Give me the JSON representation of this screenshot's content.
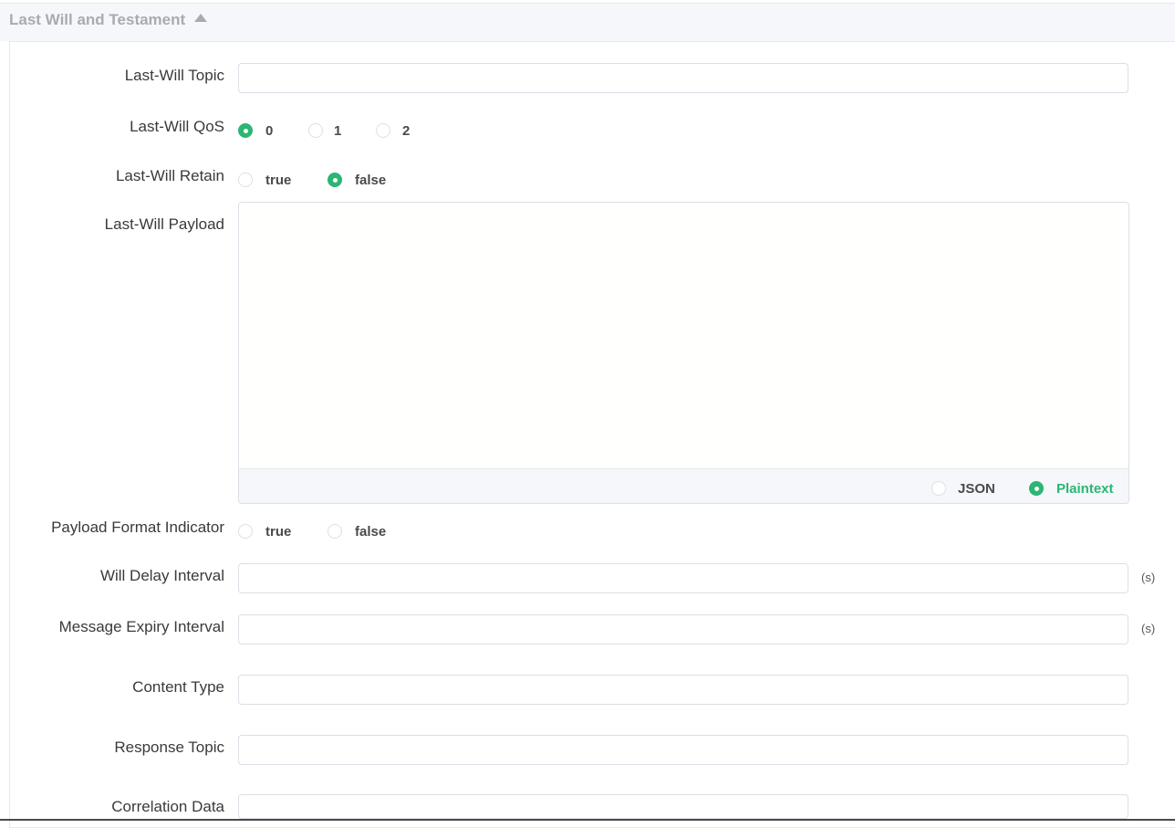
{
  "section": {
    "title": "Last Will and Testament"
  },
  "fields": {
    "topic": {
      "label": "Last-Will Topic",
      "value": ""
    },
    "qos": {
      "label": "Last-Will QoS",
      "options": [
        "0",
        "1",
        "2"
      ],
      "selected": "0"
    },
    "retain": {
      "label": "Last-Will Retain",
      "options": [
        "true",
        "false"
      ],
      "selected": "false"
    },
    "payload": {
      "label": "Last-Will Payload",
      "value": "",
      "formats": [
        "JSON",
        "Plaintext"
      ],
      "selected_format": "Plaintext"
    },
    "payload_format_indicator": {
      "label": "Payload Format Indicator",
      "options": [
        "true",
        "false"
      ],
      "selected": ""
    },
    "will_delay_interval": {
      "label": "Will Delay Interval",
      "value": "",
      "unit": "(s)"
    },
    "message_expiry_interval": {
      "label": "Message Expiry Interval",
      "value": "",
      "unit": "(s)"
    },
    "content_type": {
      "label": "Content Type",
      "value": ""
    },
    "response_topic": {
      "label": "Response Topic",
      "value": ""
    },
    "correlation_data": {
      "label": "Correlation Data",
      "value": ""
    }
  },
  "colors": {
    "accent": "#2bb673",
    "header_bg": "#f5f7fa",
    "border": "#dcdfe6"
  }
}
